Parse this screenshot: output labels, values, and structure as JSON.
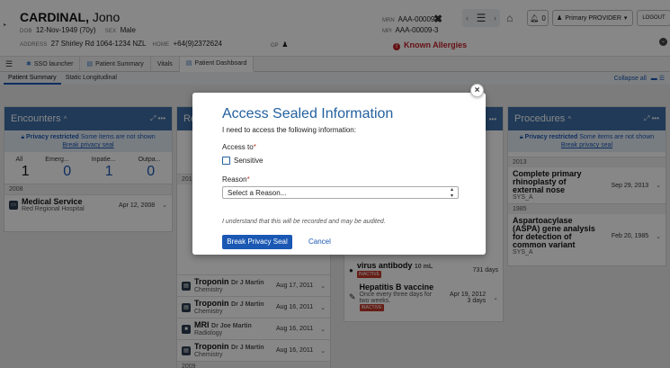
{
  "header": {
    "surname": "CARDINAL,",
    "given_name": "Jono",
    "dob_label": "DOB",
    "dob": "12-Nov-1949 (70y)",
    "sex_label": "SEX",
    "sex": "Male",
    "address_label": "ADDRESS",
    "address": "27 Shirley Rd 1064-1234 NZL",
    "home_label": "HOME",
    "home_phone": "+64(9)2372624",
    "gp_label": "GP",
    "mrn_label": "MRN",
    "mrn": "AAA-00009-3",
    "mpi_label": "MPI",
    "mpi": "AAA-00009-3",
    "allergies": "Known Allergies",
    "notifications": "0",
    "provider": "Primary PROVIDER",
    "logout": "LOGOUT"
  },
  "tabs": [
    {
      "label": "SSO launcher"
    },
    {
      "label": "Patient Summary"
    },
    {
      "label": "Vitals"
    },
    {
      "label": "Patient Dashboard"
    }
  ],
  "subtabs": [
    "Patient Summary",
    "Static Longitudinal"
  ],
  "collapse_all": "Collapse all",
  "encounters": {
    "title": "Encounters",
    "privacy_title": "Privacy restricted",
    "privacy_text": "Some items are not shown",
    "privacy_link": "Break privacy seal",
    "count_labels": [
      "All",
      "Emerg...",
      "Inpatie...",
      "Outpa..."
    ],
    "counts": [
      "1",
      "0",
      "1",
      "0"
    ],
    "year": "2008",
    "rows": [
      {
        "title": "Medical Service",
        "sub": "Red Regional Hospital",
        "date": "Apr 12, 2008"
      }
    ]
  },
  "results_panel": {
    "title": "Re",
    "year_fragment": "201",
    "year2": "2009",
    "rows": [
      {
        "title": "Troponin",
        "author": "Dr J Martin",
        "sub": "Chemistry",
        "date": "Aug 17, 2011"
      },
      {
        "title": "Troponin",
        "author": "Dr J Martin",
        "sub": "Chemistry",
        "date": "Aug 16, 2011"
      },
      {
        "title": "MRI",
        "author": "Dr Joe Martin",
        "sub": "Radiology",
        "date": "Aug 16, 2011"
      },
      {
        "title": "Troponin",
        "author": "Dr J Martin",
        "sub": "Chemistry",
        "date": "Aug 16, 2011"
      }
    ]
  },
  "meds_panel": {
    "rows": [
      {
        "title": "virus antibody",
        "dose": "10 mL",
        "right": "731 days",
        "badge": "INACTIVE"
      },
      {
        "title": "Hepatitis B vaccine",
        "sub": "Once every three days for two weeks.",
        "date": "Apr 19, 2012",
        "right": "3 days",
        "badge": "INACTIVE"
      }
    ]
  },
  "procedures": {
    "title": "Procedures",
    "privacy_title": "Privacy restricted",
    "privacy_text": "Some items are not shown",
    "privacy_link": "Break privacy seal",
    "groups": [
      {
        "year": "2013",
        "title": "Complete primary rhinoplasty of external nose",
        "code": "SYS_A",
        "date": "Sep 29, 2013"
      },
      {
        "year": "1985",
        "title": "Aspartoacylase (ASPA) gene analysis for detection of common variant",
        "code": "SYS_A",
        "date": "Feb 20, 1985"
      }
    ]
  },
  "modal": {
    "title": "Access Sealed Information",
    "intro": "I need to access the following information:",
    "access_label": "Access to",
    "checkbox_label": "Sensitive",
    "reason_label": "Reason",
    "reason_placeholder": "Select a Reason...",
    "note": "I understand that this will be recorded and may be audited.",
    "primary_button": "Break Privacy Seal",
    "cancel_button": "Cancel"
  },
  "colors": {
    "accent": "#1a58b4",
    "panel_header": "#3d6ea6",
    "allergy": "#c0232b"
  }
}
